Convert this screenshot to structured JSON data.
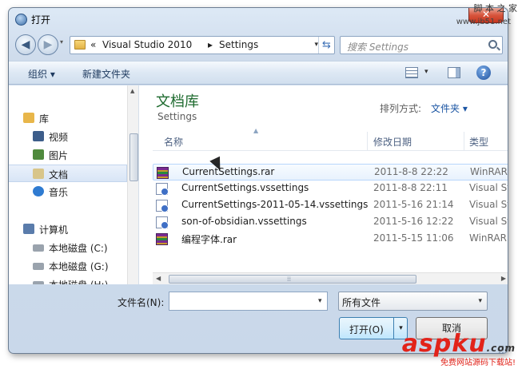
{
  "window": {
    "title": "打开",
    "close_label": "✕"
  },
  "nav": {
    "back_glyph": "◀",
    "forward_glyph": "▶",
    "address": {
      "sep": "«",
      "crumbs": [
        "Visual Studio 2010",
        "Settings"
      ],
      "crumb_sep": "▸"
    },
    "search_placeholder": "搜索 Settings"
  },
  "toolbar": {
    "organize": "组织 ▾",
    "new_folder": "新建文件夹"
  },
  "sidebar": {
    "items": [
      {
        "label": "库",
        "icon": "library-icon",
        "color": "#e8b64a"
      },
      {
        "label": "视频",
        "icon": "video-icon",
        "color": "#3d5d8a"
      },
      {
        "label": "图片",
        "icon": "pictures-icon",
        "color": "#4f8a3d"
      },
      {
        "label": "文档",
        "icon": "documents-icon",
        "color": "#d8c58a",
        "selected": true
      },
      {
        "label": "音乐",
        "icon": "music-icon",
        "color": "#2f7bd1"
      },
      {
        "label": "计算机",
        "icon": "computer-icon",
        "color": "#5a7cab"
      },
      {
        "label": "本地磁盘 (C:)",
        "icon": "drive-icon",
        "color": "#9aa3ad"
      },
      {
        "label": "本地磁盘 (G:)",
        "icon": "drive-icon",
        "color": "#9aa3ad"
      },
      {
        "label": "本地磁盘 (H:)",
        "icon": "drive-icon",
        "color": "#9aa3ad"
      }
    ]
  },
  "library": {
    "title": "文档库",
    "subtitle": "Settings",
    "arrange_label": "排列方式:",
    "arrange_value": "文件夹 ▾"
  },
  "columns": {
    "name": "名称",
    "date": "修改日期",
    "type": "类型"
  },
  "files": [
    {
      "name": "CurrentSettings.rar",
      "date": "2011-8-8 22:22",
      "type": "WinRAR",
      "icon": "rar",
      "hover": true
    },
    {
      "name": "CurrentSettings.vssettings",
      "date": "2011-8-8 22:11",
      "type": "Visual Stu",
      "icon": "vs"
    },
    {
      "name": "CurrentSettings-2011-05-14.vssettings",
      "date": "2011-5-16 21:14",
      "type": "Visual Stu",
      "icon": "vs"
    },
    {
      "name": "son-of-obsidian.vssettings",
      "date": "2011-5-16 12:22",
      "type": "Visual Stu",
      "icon": "vs"
    },
    {
      "name": "编程字体.rar",
      "date": "2011-5-15 11:06",
      "type": "WinRAR",
      "icon": "rar"
    }
  ],
  "bottom": {
    "filename_label": "文件名(N):",
    "filename_value": "",
    "filter_value": "所有文件",
    "open_label": "打开(O)",
    "cancel_label": "取消"
  },
  "watermarks": {
    "top": "脚 本 之 家",
    "url": "www.jb51.net",
    "brand": "aspku",
    "brand_domain": ".com",
    "sub": "免费网站源码下载站!"
  }
}
